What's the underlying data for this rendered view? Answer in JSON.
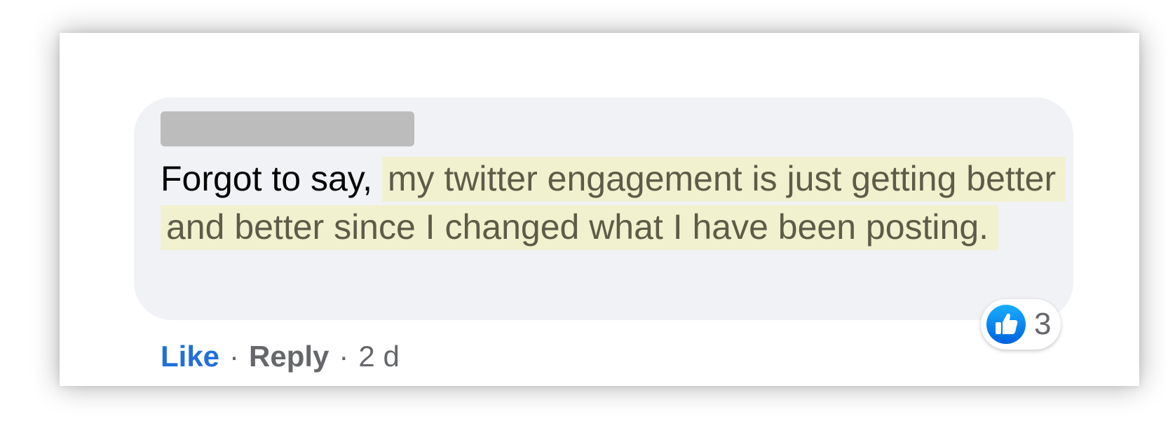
{
  "comment": {
    "author_name": "",
    "text_plain": "Forgot to say, ",
    "text_highlighted": "my twitter engagement is just getting better and better since I changed what I have been posting."
  },
  "reactions": {
    "icon": "thumbs-up-icon",
    "count": "3"
  },
  "actions": {
    "like_label": "Like",
    "separator": "·",
    "reply_label": "Reply",
    "timestamp": "2 d"
  },
  "colors": {
    "bubble_background": "#f0f2f5",
    "highlight": "#f1f1cf",
    "like_blue": "#216fdb",
    "meta_gray": "#65676b"
  }
}
